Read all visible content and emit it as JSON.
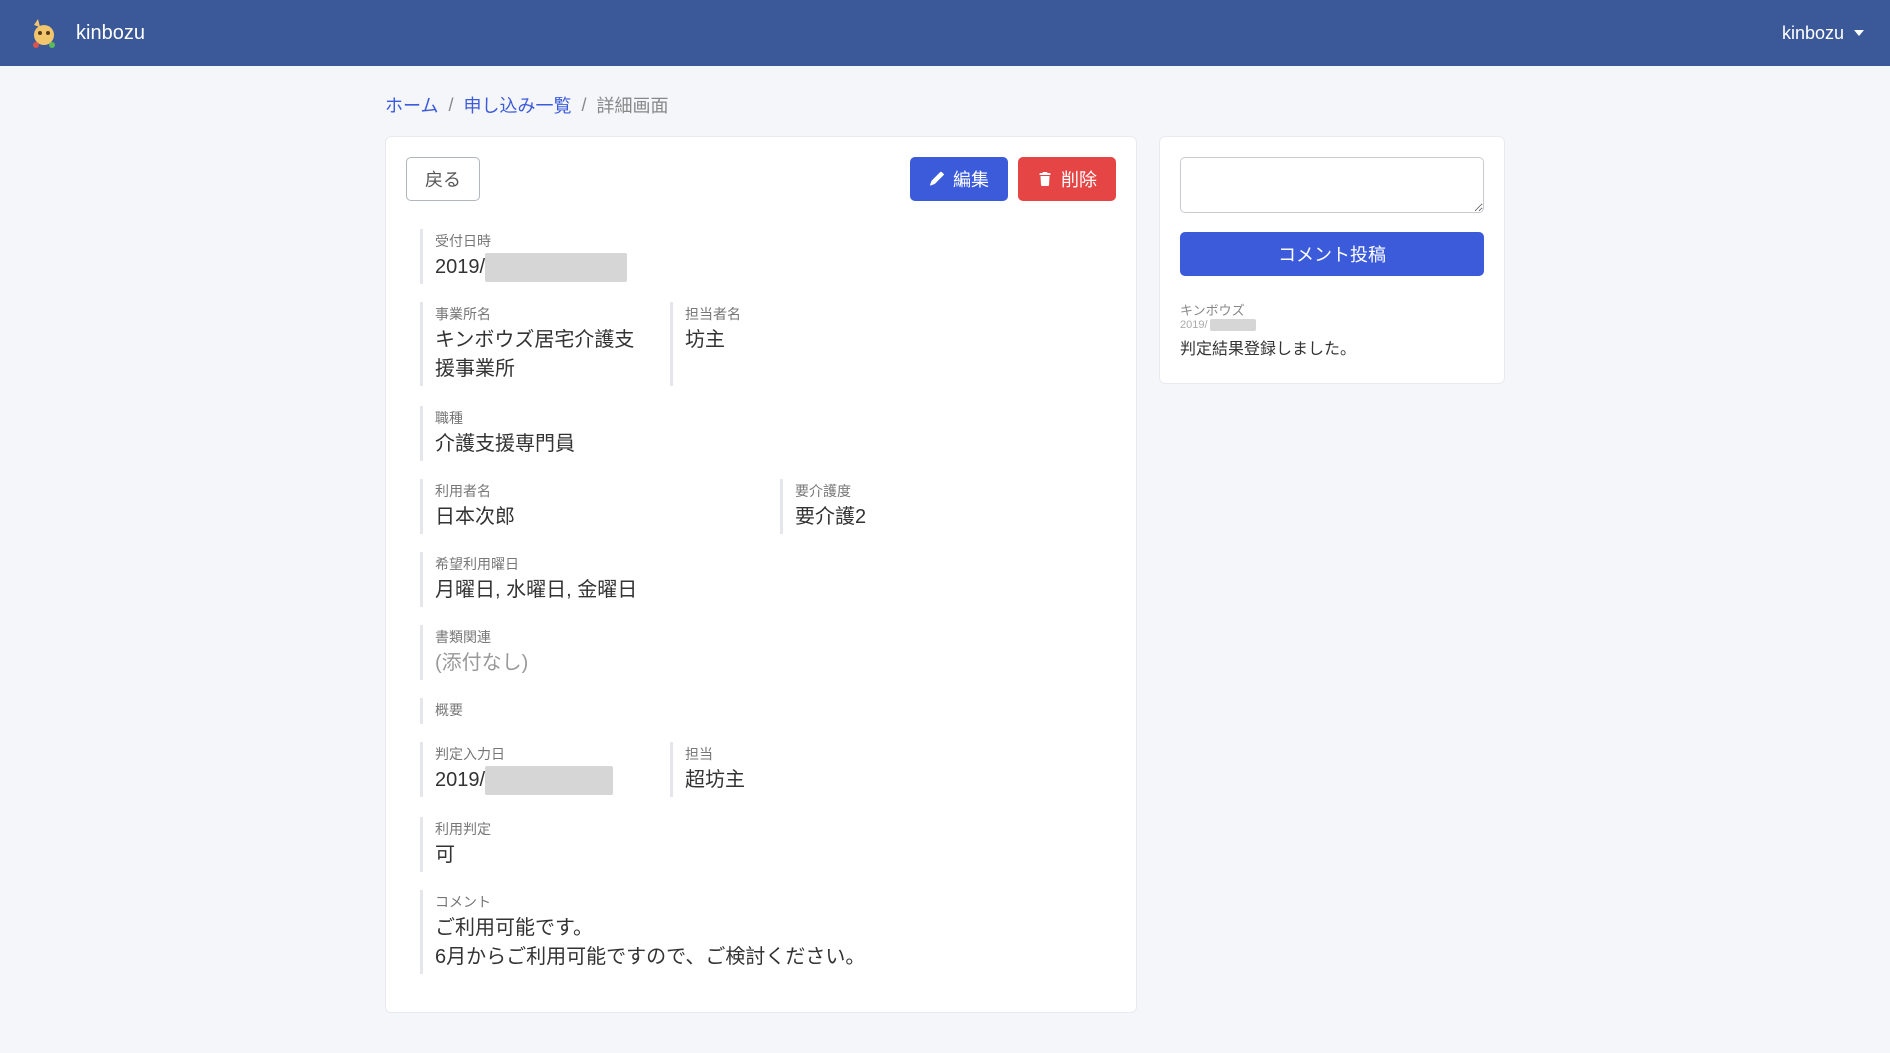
{
  "navbar": {
    "brand": "kinbozu",
    "user": "kinbozu"
  },
  "breadcrumb": {
    "home": "ホーム",
    "list": "申し込み一覧",
    "current": "詳細画面"
  },
  "toolbar": {
    "back": "戻る",
    "edit": "編集",
    "delete": "削除"
  },
  "fields": {
    "received_at_label": "受付日時",
    "received_at_prefix": "2019/",
    "received_at_hidden": "██████████",
    "office_label": "事業所名",
    "office_value": "キンボウズ居宅介護支援事業所",
    "person_label": "担当者名",
    "person_value": "坊主",
    "job_label": "職種",
    "job_value": "介護支援専門員",
    "user_name_label": "利用者名",
    "user_name_value": "日本次郎",
    "care_level_label": "要介護度",
    "care_level_value": "要介護2",
    "desired_days_label": "希望利用曜日",
    "desired_days_value": "月曜日, 水曜日, 金曜日",
    "docs_label": "書類関連",
    "docs_value": "(添付なし)",
    "overview_label": "概要",
    "overview_value": "",
    "judge_date_label": "判定入力日",
    "judge_date_prefix": "2019/",
    "judge_date_hidden": "█████████",
    "assignee_label": "担当",
    "assignee_value": "超坊主",
    "judgement_label": "利用判定",
    "judgement_value": "可",
    "comment_label": "コメント",
    "comment_line1": "ご利用可能です。",
    "comment_line2": "6月からご利用可能ですので、ご検討ください。"
  },
  "sidebar": {
    "submit": "コメント投稿",
    "comments": [
      {
        "author": "キンボウズ",
        "date_prefix": "2019/",
        "date_hidden": "██████",
        "body": "判定結果登録しました。"
      }
    ]
  }
}
